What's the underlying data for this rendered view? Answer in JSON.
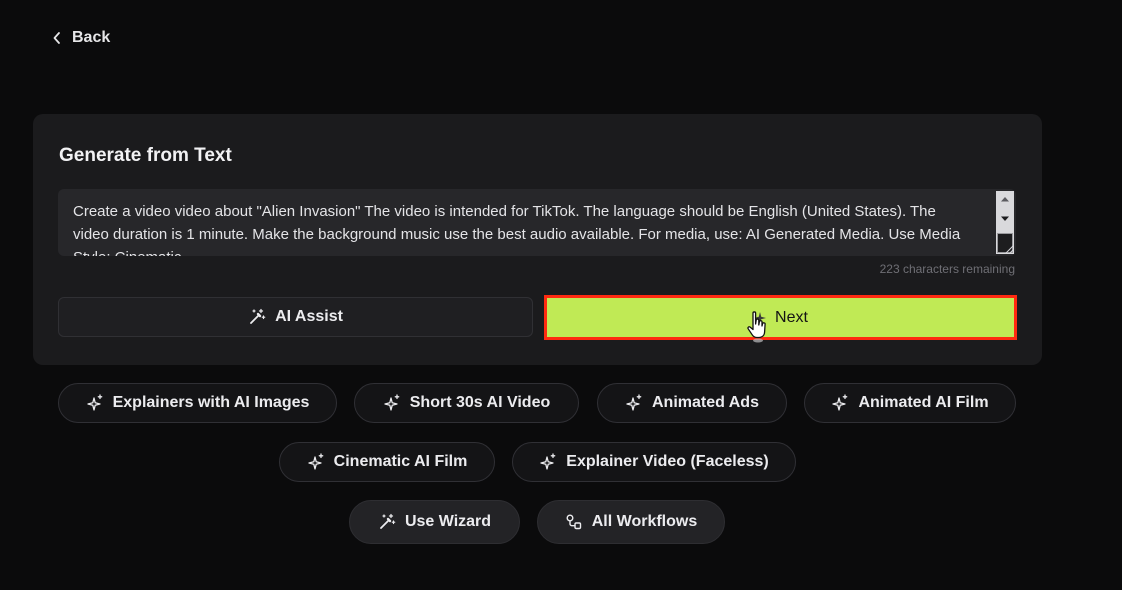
{
  "nav": {
    "back_label": "Back"
  },
  "panel": {
    "title": "Generate from Text",
    "prompt_text": "Create a video video about \"Alien Invasion\" The video is intended for TikTok. The language should be English (United States). The video duration is 1 minute. Make the background music use the best audio available. For media, use: AI Generated Media. Use Media Style: Cinematic",
    "chars_remaining": "223 characters remaining",
    "ai_assist_label": "AI Assist",
    "next_label": "Next"
  },
  "workflows": {
    "row1": [
      {
        "label": "Explainers with AI Images",
        "icon": "sparkles-icon"
      },
      {
        "label": "Short 30s AI Video",
        "icon": "sparkles-icon"
      },
      {
        "label": "Animated Ads",
        "icon": "sparkles-icon"
      },
      {
        "label": "Animated AI Film",
        "icon": "sparkles-icon"
      }
    ],
    "row2": [
      {
        "label": "Cinematic AI Film",
        "icon": "sparkles-icon"
      },
      {
        "label": "Explainer Video (Faceless)",
        "icon": "sparkles-icon"
      }
    ],
    "row3": [
      {
        "label": "Use Wizard",
        "icon": "magic-wand-icon"
      },
      {
        "label": "All Workflows",
        "icon": "workflow-icon"
      }
    ]
  },
  "colors": {
    "background": "#0b0b0c",
    "panel": "#1b1b1d",
    "accent": "#c0ea55",
    "highlight": "#ff2a10"
  }
}
